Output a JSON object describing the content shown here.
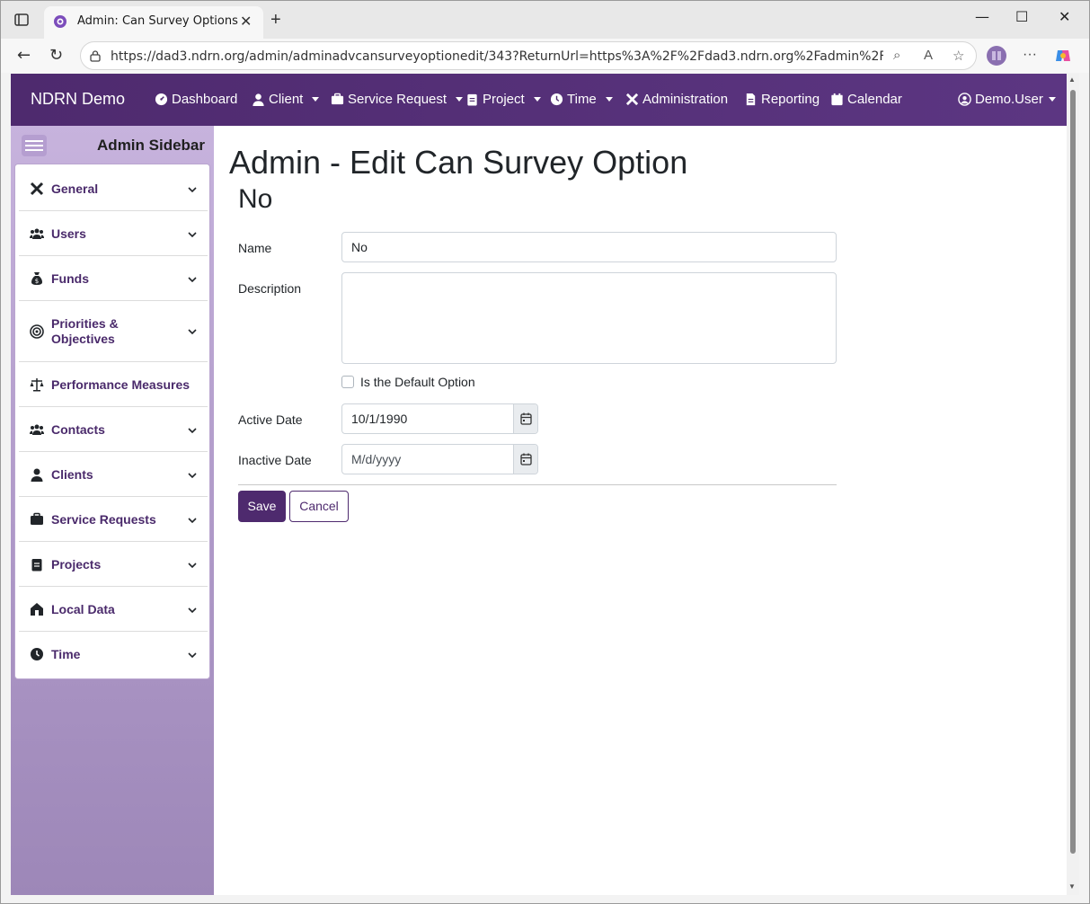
{
  "browser": {
    "tab_title": "Admin: Can Survey Options",
    "url": "https://dad3.ndrn.org/admin/adminadvcansurveyoptionedit/343?ReturnUrl=https%3A%2F%2Fdad3.ndrn.org%2Fadmin%2Fadmindisplaya..."
  },
  "navbar": {
    "brand": "NDRN Demo",
    "items": [
      {
        "label": "Dashboard",
        "icon": "dashboard-icon",
        "dropdown": false
      },
      {
        "label": "Client",
        "icon": "user-icon",
        "dropdown": true
      },
      {
        "label": "Service Request",
        "icon": "briefcase-icon",
        "dropdown": true
      },
      {
        "label": "Project",
        "icon": "clipboard-icon",
        "dropdown": true
      },
      {
        "label": "Time",
        "icon": "clock-icon",
        "dropdown": true
      },
      {
        "label": "Administration",
        "icon": "tools-icon",
        "dropdown": false
      },
      {
        "label": "Reporting",
        "icon": "file-icon",
        "dropdown": false
      },
      {
        "label": "Calendar",
        "icon": "calendar-icon",
        "dropdown": false
      }
    ],
    "user": "Demo.User"
  },
  "sidebar": {
    "title": "Admin Sidebar",
    "items": [
      {
        "label": "General",
        "icon": "tools-icon",
        "expandable": true
      },
      {
        "label": "Users",
        "icon": "users-icon",
        "expandable": true
      },
      {
        "label": "Funds",
        "icon": "money-bag-icon",
        "expandable": true
      },
      {
        "label": "Priorities & Objectives",
        "icon": "target-icon",
        "expandable": true
      },
      {
        "label": "Performance Measures",
        "icon": "scale-icon",
        "expandable": false
      },
      {
        "label": "Contacts",
        "icon": "users-icon",
        "expandable": true
      },
      {
        "label": "Clients",
        "icon": "user-icon",
        "expandable": true
      },
      {
        "label": "Service Requests",
        "icon": "briefcase-icon",
        "expandable": true
      },
      {
        "label": "Projects",
        "icon": "clipboard-icon",
        "expandable": true
      },
      {
        "label": "Local Data",
        "icon": "house-icon",
        "expandable": true
      },
      {
        "label": "Time",
        "icon": "clock-icon",
        "expandable": true
      }
    ]
  },
  "page": {
    "title": "Admin - Edit Can Survey Option",
    "subtitle": "No",
    "form": {
      "name_label": "Name",
      "name_value": "No",
      "description_label": "Description",
      "description_value": "",
      "default_label": "Is the Default Option",
      "default_checked": false,
      "active_date_label": "Active Date",
      "active_date_value": "10/1/1990",
      "inactive_date_label": "Inactive Date",
      "inactive_date_placeholder": "M/d/yyyy",
      "save_label": "Save",
      "cancel_label": "Cancel"
    }
  },
  "colors": {
    "brand_purple": "#4e2a6e",
    "sidebar_bg": "#b09ac9",
    "sidebar_link": "#4a2a6b"
  }
}
